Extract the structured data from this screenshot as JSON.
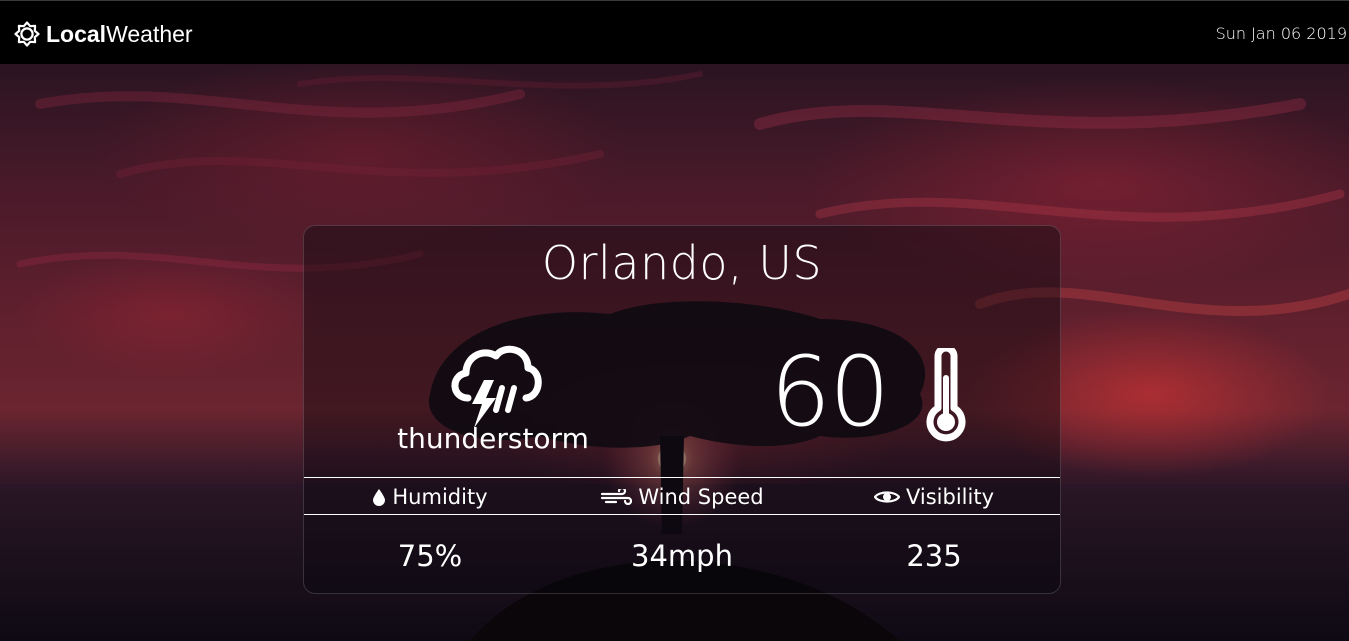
{
  "header": {
    "brand_bold": "Local",
    "brand_regular": "Weather",
    "brand_icon": "sun-outline-icon",
    "date": "Sun Jan 06 2019"
  },
  "weather": {
    "location": "Orlando, US",
    "condition": "thunderstorm",
    "condition_icon": "thunderstorm-icon",
    "temperature": "60",
    "temperature_icon": "thermometer-icon"
  },
  "stats": [
    {
      "label": "Humidity",
      "icon": "droplet-icon",
      "value": "75%"
    },
    {
      "label": "Wind Speed",
      "icon": "wind-icon",
      "value": "34mph"
    },
    {
      "label": "Visibility",
      "icon": "eye-icon",
      "value": "235"
    }
  ],
  "colors": {
    "nav_background": "#000000",
    "text": "#ffffff",
    "sky_accent": "#d63434"
  }
}
